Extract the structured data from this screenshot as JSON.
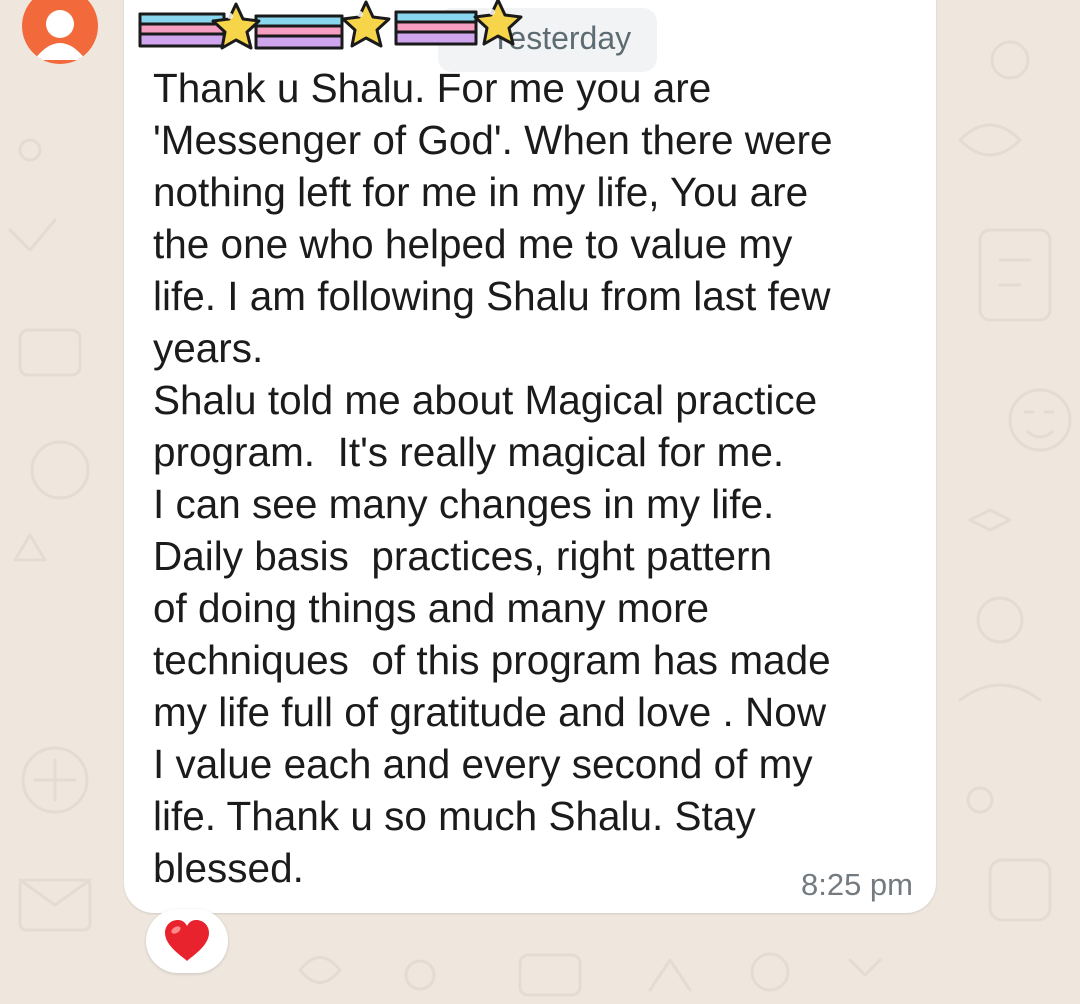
{
  "chat": {
    "date_chip": "Yesterday",
    "message": {
      "text": "Thank u Shalu. For me you are\n'Messenger of God'. When there were\nnothing left for me in my life, You are\nthe one who helped me to value my\nlife. I am following Shalu from last few\nyears.\nShalu told me about Magical practice\nprogram.  It's really magical for me.\nI can see many changes in my life.\nDaily basis  practices, right pattern\nof doing things and many more\ntechniques  of this program has made\nmy life full of gratitude and love . Now\nI value each and every second of my\nlife. Thank u so much Shalu. Stay\nblessed.",
      "time": "8:25 pm",
      "reaction": "red-heart-icon"
    },
    "sender_avatar": "person-icon",
    "overlay": "stars-rainbow-sticker"
  },
  "colors": {
    "background": "#efe7de",
    "bubble": "#ffffff",
    "text": "#1b1b1b",
    "timestamp": "#737b80",
    "avatar": "#f26a3b",
    "heart": "#e8232d"
  }
}
